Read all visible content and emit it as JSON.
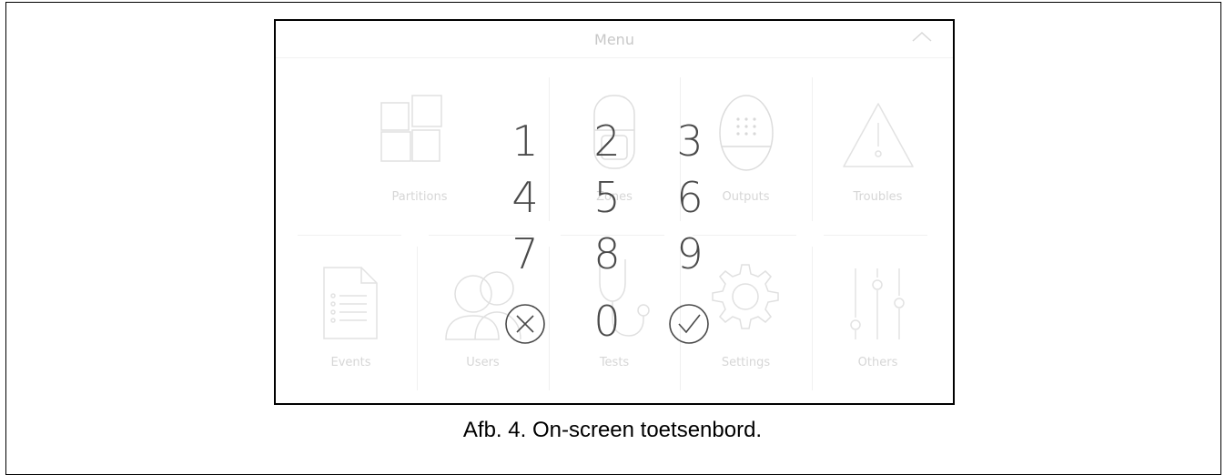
{
  "menu": {
    "title": "Menu",
    "collapse_icon": "chevron-up-icon",
    "tiles": [
      {
        "label": "Partitions",
        "icon": "partitions-icon"
      },
      {
        "label": "Zones",
        "icon": "zones-icon"
      },
      {
        "label": "Outputs",
        "icon": "outputs-icon"
      },
      {
        "label": "Troubles",
        "icon": "troubles-icon"
      },
      {
        "label": "Events",
        "icon": "events-icon"
      },
      {
        "label": "Users",
        "icon": "users-icon"
      },
      {
        "label": "Tests",
        "icon": "tests-icon"
      },
      {
        "label": "Settings",
        "icon": "settings-icon"
      },
      {
        "label": "Others",
        "icon": "others-icon"
      }
    ]
  },
  "keypad": {
    "keys": [
      "1",
      "2",
      "3",
      "4",
      "5",
      "6",
      "7",
      "8",
      "9",
      "0"
    ],
    "cancel_icon": "cancel-circle-icon",
    "confirm_icon": "confirm-check-icon"
  },
  "caption": "Afb. 4. On-screen toetsenbord."
}
